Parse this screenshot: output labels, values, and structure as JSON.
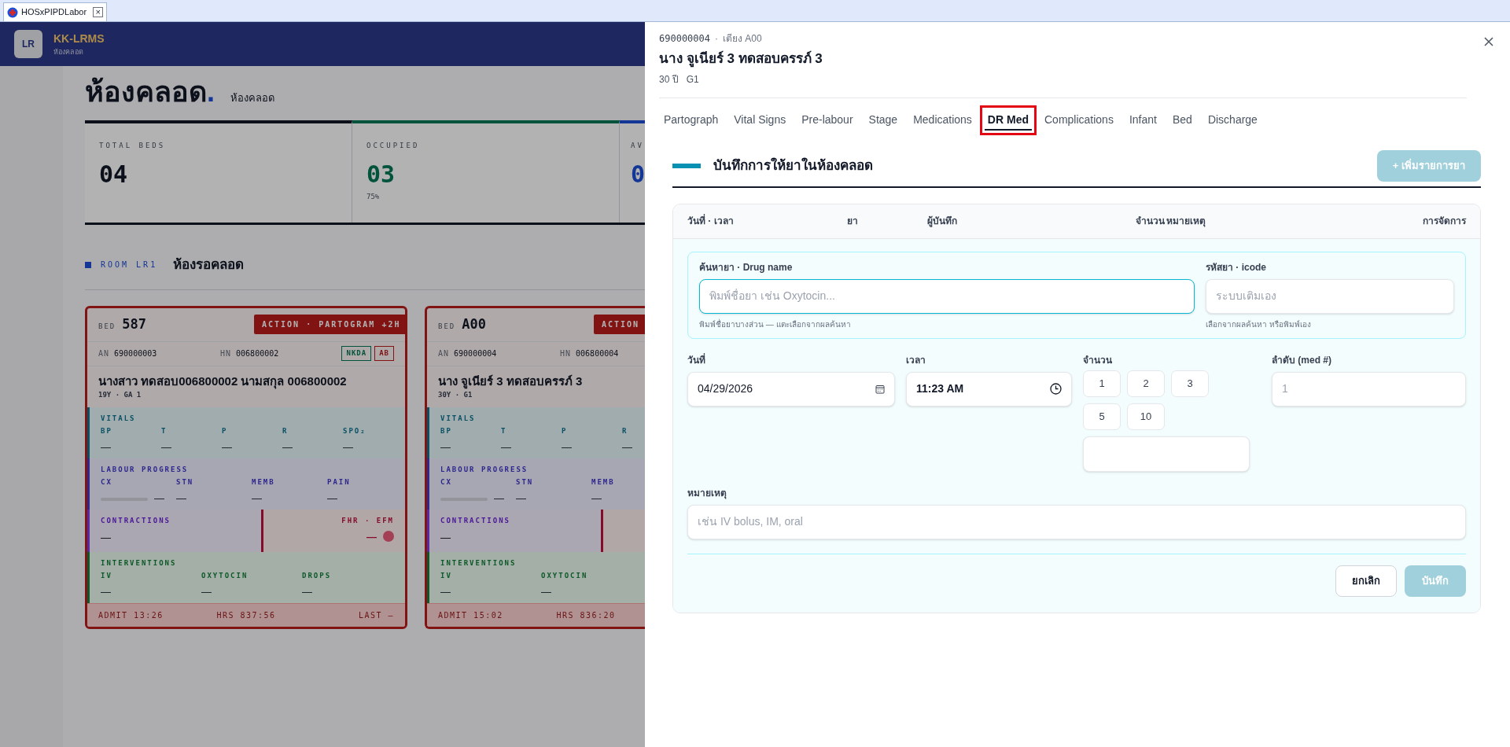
{
  "app_tab": {
    "title": "HOSxPIPDLabor",
    "close": "×"
  },
  "header": {
    "logo": "LR",
    "name": "KK-LRMS",
    "subtitle": "ห้องคลอด"
  },
  "page": {
    "title": "ห้องคลอด",
    "title_mark": ".",
    "subtitle": "ห้องคลอด"
  },
  "stats": [
    {
      "label": "TOTAL BEDS",
      "value": "04",
      "color": "#0c111b"
    },
    {
      "label": "OCCUPIED",
      "value": "03",
      "note": "75%",
      "color": "#03543d"
    },
    {
      "label": "AV",
      "value": "0",
      "color": "#143797"
    }
  ],
  "room": {
    "code": "ROOM LR1",
    "name": "ห้องรอคลอด"
  },
  "cards": [
    {
      "bed_label": "BED",
      "bed": "587",
      "action": "ACTION · PARTOGRAM +2H",
      "an_label": "AN",
      "an": "690000003",
      "hn_label": "HN",
      "hn": "006800002",
      "tags": [
        {
          "label": "NKDA",
          "color": "#03543d"
        },
        {
          "label": "AB",
          "color": "#821414"
        }
      ],
      "name": "นางสาว ทดสอบ006800002 นามสกุล 006800002",
      "meta": "19Y · GA 1",
      "vitals": {
        "title": "VITALS",
        "items": [
          {
            "label": "BP",
            "value": "—"
          },
          {
            "label": "T",
            "value": "—"
          },
          {
            "label": "P",
            "value": "—"
          },
          {
            "label": "R",
            "value": "—"
          },
          {
            "label": "SPO₂",
            "value": "—"
          }
        ]
      },
      "labour": {
        "title": "LABOUR PROGRESS",
        "items": [
          {
            "kind": "bar",
            "label": "CX",
            "value": "—",
            "level": 0
          },
          {
            "kind": "text",
            "label": "STN",
            "value": "—"
          },
          {
            "kind": "text",
            "label": "MEMB",
            "value": "—"
          },
          {
            "kind": "text",
            "label": "PAIN",
            "value": "—"
          }
        ]
      },
      "contractions": {
        "title": "CONTRACTIONS",
        "value": "—"
      },
      "fhr": {
        "title": "FHR · EFM",
        "value": "—"
      },
      "interventions": {
        "title": "INTERVENTIONS",
        "items": [
          {
            "label": "IV",
            "value": "—"
          },
          {
            "label": "OXYTOCIN",
            "value": "—"
          },
          {
            "label": "DROPS",
            "value": "—"
          }
        ]
      },
      "footer": {
        "admit": "ADMIT 13:26",
        "hrs": "HRS 837:56",
        "last": "LAST —"
      }
    },
    {
      "bed_label": "BED",
      "bed": "A00",
      "action": "ACTION",
      "an_label": "AN",
      "an": "690000004",
      "hn_label": "HN",
      "hn": "006800004",
      "name": "นาง จูเนียร์ 3 ทดสอบครรภ์ 3",
      "meta": "30Y · G1",
      "vitals": {
        "title": "VITALS",
        "items": [
          {
            "label": "BP",
            "value": "—"
          },
          {
            "label": "T",
            "value": "—"
          },
          {
            "label": "P",
            "value": "—"
          },
          {
            "label": "R",
            "value": "—"
          }
        ]
      },
      "labour": {
        "title": "LABOUR PROGRESS",
        "items": [
          {
            "kind": "bar",
            "label": "CX",
            "value": "—",
            "level": 0
          },
          {
            "kind": "text",
            "label": "STN",
            "value": "—"
          },
          {
            "kind": "text",
            "label": "MEMB",
            "value": "—"
          }
        ]
      },
      "contractions": {
        "title": "CONTRACTIONS",
        "value": "—"
      },
      "interventions": {
        "title": "INTERVENTIONS",
        "items": [
          {
            "label": "IV",
            "value": "—"
          },
          {
            "label": "OXYTOCIN",
            "value": "—"
          }
        ]
      },
      "footer": {
        "admit": "ADMIT 15:02",
        "hrs": "HRS 836:20"
      }
    }
  ],
  "drawer": {
    "an": "690000004",
    "separator": "·",
    "bed": "เตียง A00",
    "name": "นาง จูเนียร์ 3 ทดสอบครรภ์ 3",
    "age": "30 ปี",
    "gravida": "G1",
    "tabs": [
      {
        "label": "Partograph",
        "selected": false,
        "highlighted": false
      },
      {
        "label": "Vital Signs",
        "selected": false,
        "highlighted": false
      },
      {
        "label": "Pre-labour",
        "selected": false,
        "highlighted": false
      },
      {
        "label": "Stage",
        "selected": false,
        "highlighted": false
      },
      {
        "label": "Medications",
        "selected": false,
        "highlighted": false
      },
      {
        "label": "DR Med",
        "selected": true,
        "highlighted": true
      },
      {
        "label": "Complications",
        "selected": false,
        "highlighted": false
      },
      {
        "label": "Infant",
        "selected": false,
        "highlighted": false
      },
      {
        "label": "Bed",
        "selected": false,
        "highlighted": false
      },
      {
        "label": "Discharge",
        "selected": false,
        "highlighted": false
      }
    ],
    "section_title": "บันทึกการให้ยาในห้องคลอด",
    "add_button": {
      "label": "+ เพิ่มรายการยา",
      "disabled": true
    },
    "columns": [
      "วันที่ · เวลา",
      "ยา",
      "ผู้บันทึก",
      "จำนวน",
      "หมายเหตุ",
      "การจัดการ"
    ],
    "form": {
      "drug": {
        "label": "ค้นหายา · Drug name",
        "placeholder": "พิมพ์ชื่อยา เช่น Oxytocin...",
        "hint": "พิมพ์ชื่อยาบางส่วน — แตะเลือกจากผลค้นหา",
        "focused": true
      },
      "icode": {
        "label": "รหัสยา · icode",
        "placeholder": "ระบบเติมเอง",
        "hint": "เลือกจากผลค้นหา หรือพิมพ์เอง",
        "focused": false
      },
      "date": {
        "label": "วันที่",
        "value": "04/29/2026"
      },
      "time": {
        "label": "เวลา",
        "value": "11:23 AM"
      },
      "qty": {
        "label": "จำนวน",
        "options": [
          {
            "label": "1",
            "selected": false
          },
          {
            "label": "2",
            "selected": false
          },
          {
            "label": "3",
            "selected": false
          },
          {
            "label": "5",
            "selected": false
          },
          {
            "label": "10",
            "selected": false
          }
        ]
      },
      "order": {
        "label": "ลำดับ (med #)",
        "placeholder": "1"
      },
      "note": {
        "label": "หมายเหตุ",
        "placeholder": "เช่น IV bolus, IM, oral"
      },
      "cancel": {
        "label": "ยกเลิก",
        "disabled": false
      },
      "save": {
        "label": "บันทึก",
        "disabled": true
      }
    }
  }
}
